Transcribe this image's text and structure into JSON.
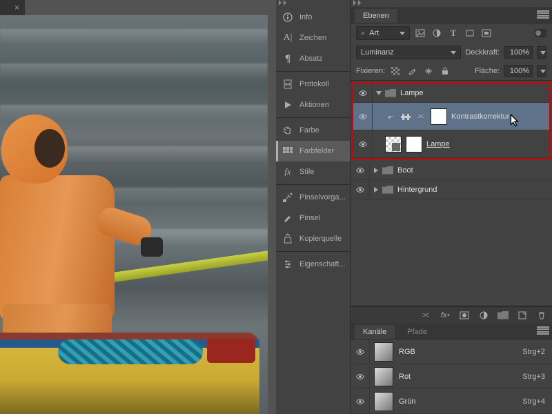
{
  "canvas": {
    "tab_close": "×"
  },
  "tool_panel": {
    "items": [
      {
        "icon": "info",
        "label": "Info"
      },
      {
        "icon": "char",
        "label": "Zeichen"
      },
      {
        "icon": "para",
        "label": "Absatz"
      },
      {
        "sep": true
      },
      {
        "icon": "hist",
        "label": "Protokoll"
      },
      {
        "icon": "play",
        "label": "Aktionen"
      },
      {
        "sep": true
      },
      {
        "icon": "pal",
        "label": "Farbe"
      },
      {
        "icon": "swatch",
        "label": "Farbfelder",
        "selected": true
      },
      {
        "icon": "fx",
        "label": "Stile"
      },
      {
        "sep": true
      },
      {
        "icon": "brushp",
        "label": "Pinselvorga..."
      },
      {
        "icon": "brush",
        "label": "Pinsel"
      },
      {
        "icon": "clone",
        "label": "Kopierquelle"
      },
      {
        "sep": true
      },
      {
        "icon": "prop",
        "label": "Eigenschaft..."
      }
    ]
  },
  "layers_panel": {
    "tab": "Ebenen",
    "filter": {
      "search_icon": "⌕",
      "label": "Art",
      "icons": [
        "image",
        "adjust",
        "type",
        "shape",
        "smart"
      ]
    },
    "blend_mode": "Luminanz",
    "opacity_label": "Deckkraft:",
    "opacity_value": "100%",
    "lock_label": "Fixieren:",
    "fill_label": "Fläche:",
    "fill_value": "100%",
    "groups": [
      {
        "name": "Lampe",
        "open": true,
        "highlighted": true,
        "children": [
          {
            "type": "adjust",
            "name": "Kontrastkorrektur",
            "selected": true,
            "cursor": true
          },
          {
            "type": "layer",
            "name": "Lampe",
            "underline": true
          }
        ]
      },
      {
        "name": "Boot",
        "open": false
      },
      {
        "name": "Hintergrund",
        "open": false
      }
    ],
    "bottom_icons": [
      "link",
      "fx",
      "mask",
      "adjust",
      "group",
      "new",
      "trash"
    ]
  },
  "channels_panel": {
    "tabs": [
      "Kanäle",
      "Pfade"
    ],
    "active": 0,
    "channels": [
      {
        "name": "RGB",
        "shortcut": "Strg+2"
      },
      {
        "name": "Rot",
        "shortcut": "Strg+3"
      },
      {
        "name": "Grün",
        "shortcut": "Strg+4"
      }
    ]
  }
}
